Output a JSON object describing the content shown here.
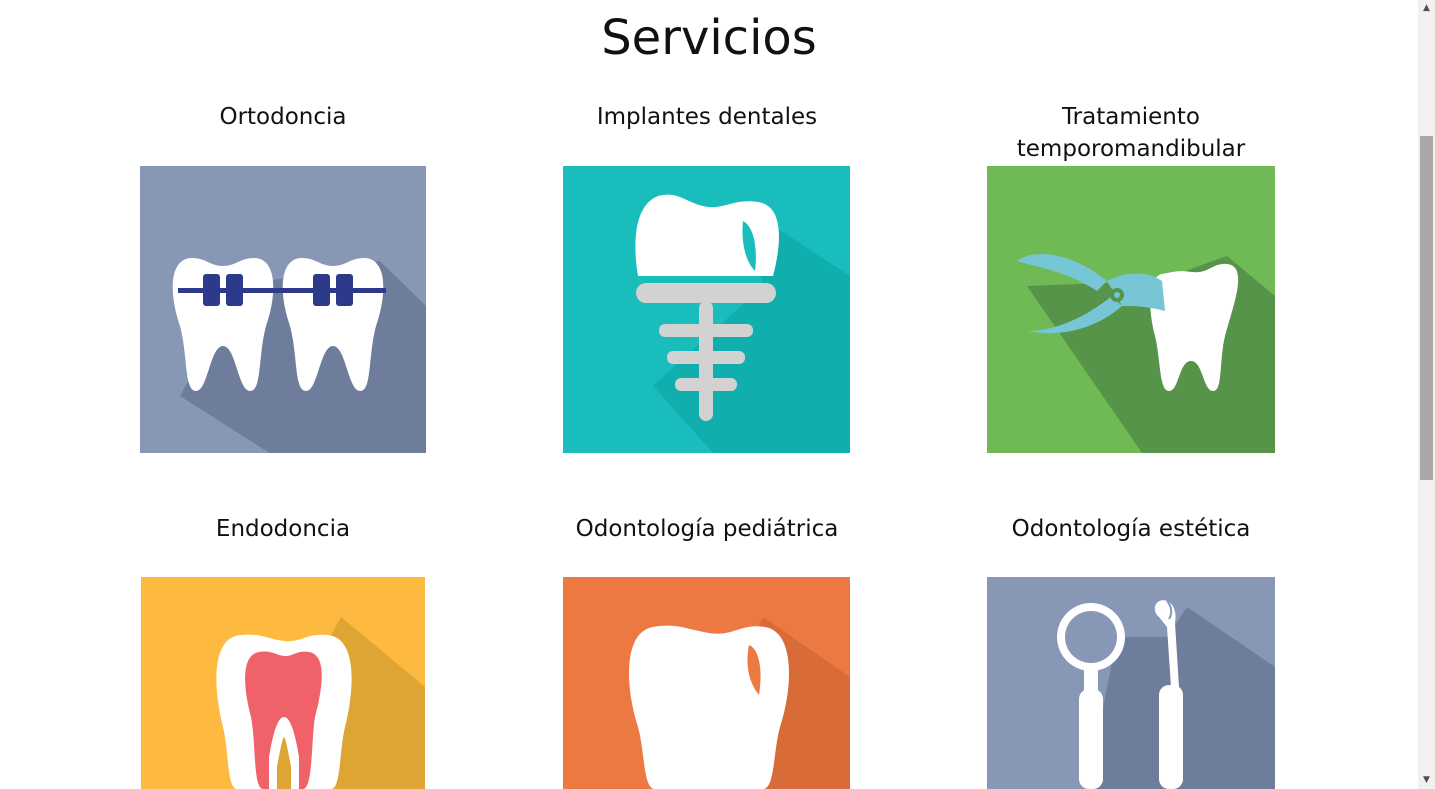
{
  "page": {
    "title": "Servicios"
  },
  "services": [
    {
      "title": "Ortodoncia",
      "icon": "braces-icon",
      "bg": "#8797b5"
    },
    {
      "title": "Implantes dentales",
      "icon": "implant-icon",
      "bg": "#18bdbc"
    },
    {
      "title": "Tratamiento temporomandibular",
      "icon": "extraction-forceps-icon",
      "bg": "#6fba55"
    },
    {
      "title": "Endodoncia",
      "icon": "tooth-root-canal-icon",
      "bg": "#fdb940"
    },
    {
      "title": "Odontología pediátrica",
      "icon": "tooth-icon",
      "bg": "#ec7942"
    },
    {
      "title": "Odontología estética",
      "icon": "dental-tools-icon",
      "bg": "#8797b5"
    }
  ],
  "scrollbar": {
    "up_glyph": "▲",
    "down_glyph": "▼"
  }
}
